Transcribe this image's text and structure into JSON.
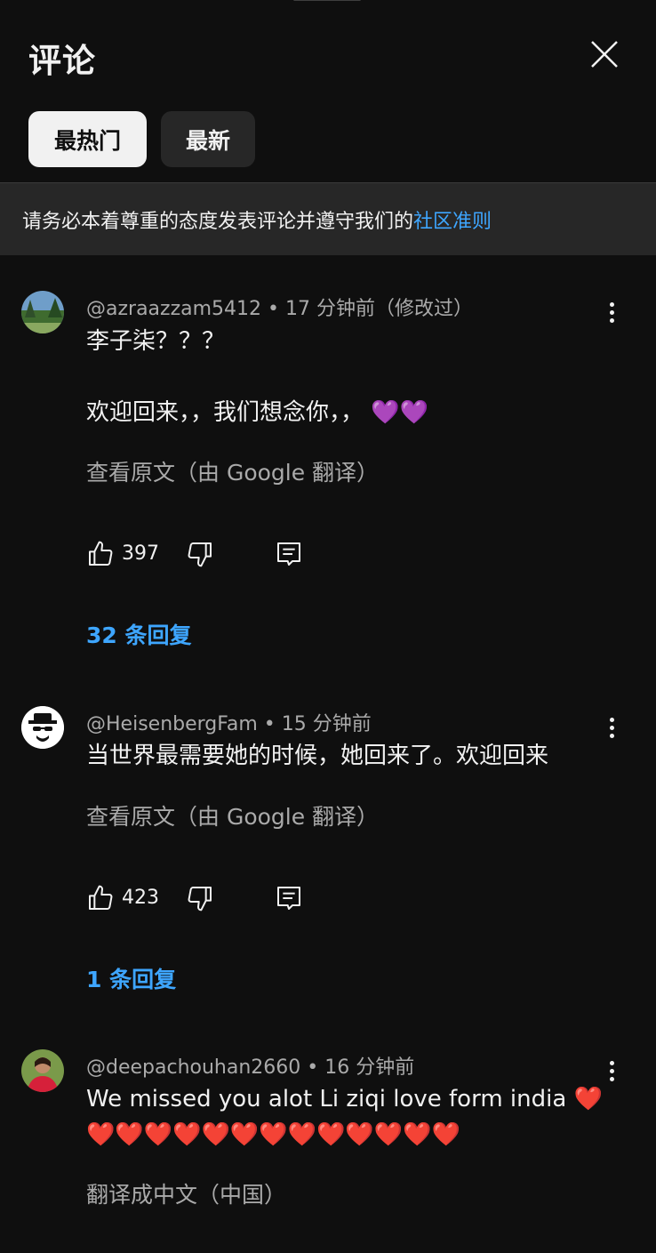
{
  "panel": {
    "title": "评论",
    "close_label": "close"
  },
  "tabs": [
    {
      "label": "最热门",
      "active": true
    },
    {
      "label": "最新",
      "active": false
    }
  ],
  "notice": {
    "text": "请务必本着尊重的态度发表评论并遵守我们的",
    "link": "社区准则"
  },
  "comments": [
    {
      "author": "@azraazzam5412",
      "time": "17 分钟前（修改过）",
      "lines": [
        "李子柒？？？",
        "",
        "欢迎回来，，我们想念你，，"
      ],
      "emoji_line": "💜💜",
      "translate": "查看原文（由 Google 翻译）",
      "likes": "397",
      "replies": "32 条回复"
    },
    {
      "author": "@HeisenbergFam",
      "time": "15 分钟前",
      "lines": [
        "当世界最需要她的时候，她回来了。欢迎回来"
      ],
      "translate": "查看原文（由 Google 翻译）",
      "likes": "423",
      "replies": "1 条回复"
    },
    {
      "author": "@deepachouhan2660",
      "time": "16 分钟前",
      "lines": [
        "We missed you alot Li ziqi love form india"
      ],
      "hearts_line1": "❤️",
      "hearts_line2": "❤️❤️❤️❤️❤️❤️❤️❤️❤️❤️❤️❤️❤️",
      "translate": "翻译成中文（中国）"
    }
  ],
  "separator": " • ",
  "colors": {
    "background": "#0f0f0f",
    "link": "#3ea6ff",
    "muted": "#aaaaaa",
    "chip_active": "#f1f1f1",
    "chip_inactive": "#272727"
  }
}
